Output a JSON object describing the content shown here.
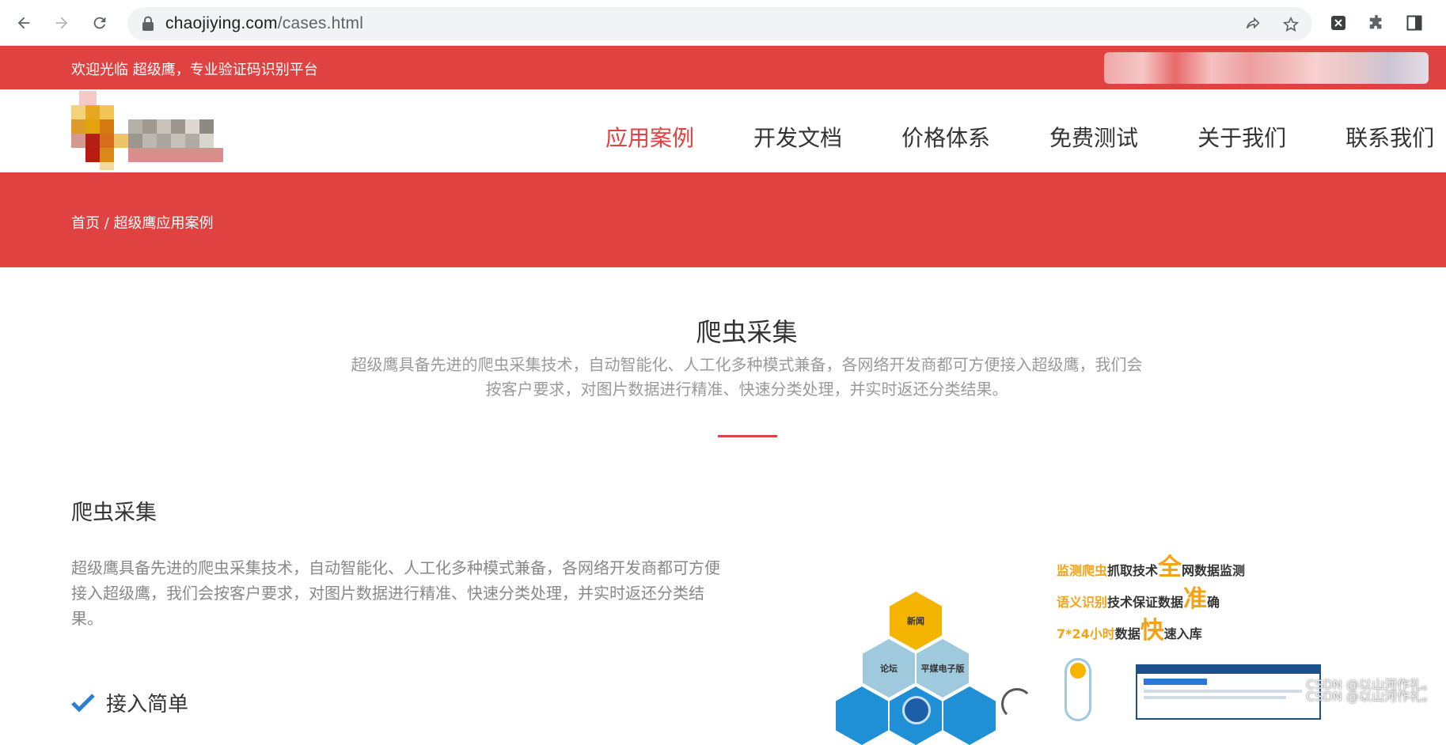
{
  "browser": {
    "url_host": "chaojiying.com",
    "url_path": "/cases.html"
  },
  "topbar": {
    "welcome": "欢迎光临 超级鹰，专业验证码识别平台"
  },
  "nav": {
    "items": [
      "应用案例",
      "开发文档",
      "价格体系",
      "免费测试",
      "关于我们",
      "联系我们"
    ],
    "active_index": 0
  },
  "breadcrumb": {
    "text": "首页 / 超级鹰应用案例"
  },
  "section": {
    "title": "爬虫采集",
    "desc_line1": "超级鹰具备先进的爬虫采集技术，自动智能化、人工化多种模式兼备，各网络开发商都可方便接入超级鹰，我们会",
    "desc_line2": "按客户要求，对图片数据进行精准、快速分类处理，并实时返还分类结果。"
  },
  "case": {
    "title": "爬虫采集",
    "text": "超级鹰具备先进的爬虫采集技术，自动智能化、人工化多种模式兼备，各网络开发商都可方便接入超级鹰，我们会按客户要求，对图片数据进行精准、快速分类处理，并实时返还分类结果。",
    "feature_label": "接入简单"
  },
  "illustration": {
    "line1_a": "监测爬虫",
    "line1_b": "抓取技术",
    "line1_big": "全",
    "line1_c": "网数据监测",
    "line2_a": "语义识别",
    "line2_b": "技术保证数据",
    "line2_big": "准",
    "line2_c": "确",
    "line3_a": "7*24小时",
    "line3_b": "数据",
    "line3_big": "快",
    "line3_c": "速入库",
    "hex_news": "新闻",
    "hex_forum": "论坛",
    "hex_media": "平媒电子版"
  },
  "watermark": {
    "line1": "CSDN @以山河作礼。",
    "line2": "CSDN @以山河作礼。"
  },
  "colors": {
    "brand_red": "#e04141",
    "accent_orange": "#f4a316"
  }
}
